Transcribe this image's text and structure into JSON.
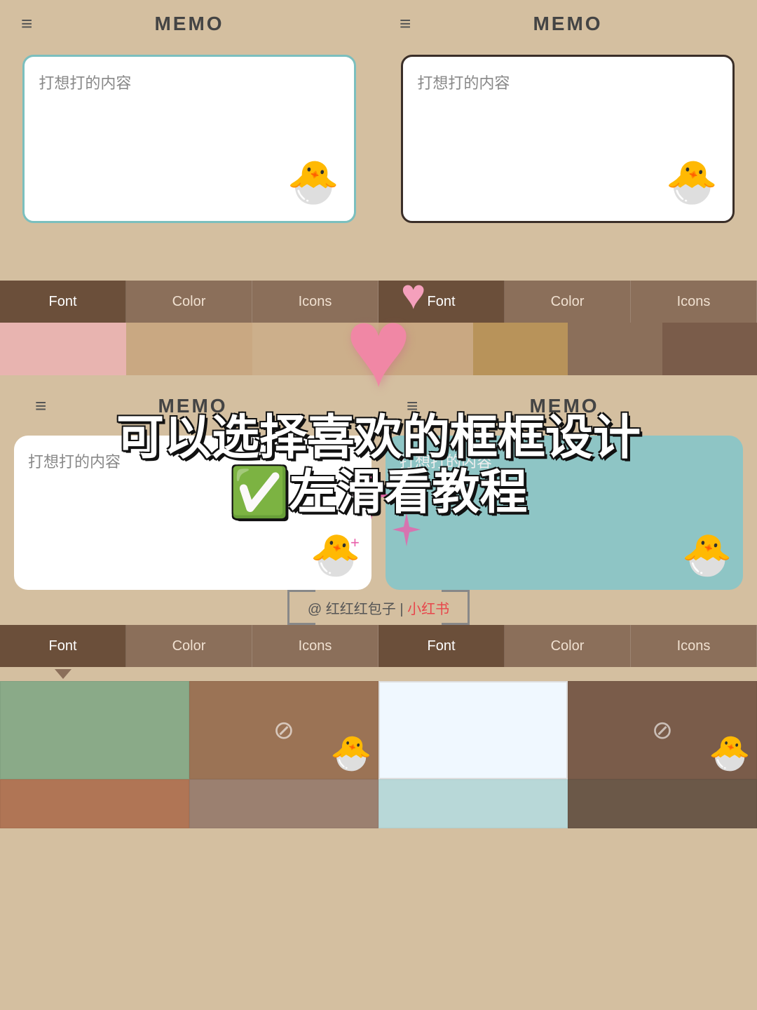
{
  "app": {
    "title": "MEMO",
    "menu_icon": "≡"
  },
  "top_left": {
    "header_title": "MEMO",
    "memo_placeholder": "打想打的内容",
    "border_style": "teal",
    "tabs": [
      "Font",
      "Color",
      "Icons"
    ]
  },
  "top_right": {
    "header_title": "MEMO",
    "memo_placeholder": "打想打的内容",
    "border_style": "dark",
    "tabs": [
      "Font",
      "Color",
      "Icons"
    ]
  },
  "overlay": {
    "line1": "可以选择喜欢的框框设计",
    "line2": "✅左滑看教程"
  },
  "bottom_left": {
    "header_title": "MEMO",
    "memo_placeholder": "打想打的内容",
    "border_style": "rounded-white"
  },
  "bottom_right": {
    "header_title": "MEMO",
    "memo_placeholder": "打想打的内容",
    "border_style": "teal-fill"
  },
  "bottom_tabs_left": [
    "Font",
    "Color",
    "Icons"
  ],
  "bottom_tabs_right": [
    "Font",
    "Color",
    "Icons"
  ],
  "watermark": {
    "prefix": "@ 红红红包子",
    "separator": " | ",
    "brand": "小红书"
  },
  "swatches": [
    {
      "color": "#8aaa88",
      "type": "plain"
    },
    {
      "color": "#9b7355",
      "type": "duck"
    },
    {
      "color": "#eaf2f8",
      "type": "plain"
    },
    {
      "color": "#7a5c4a",
      "type": "duck"
    },
    {
      "color": "#b0876a",
      "type": "partial"
    },
    {
      "color": "#9b8070",
      "type": "partial"
    }
  ]
}
